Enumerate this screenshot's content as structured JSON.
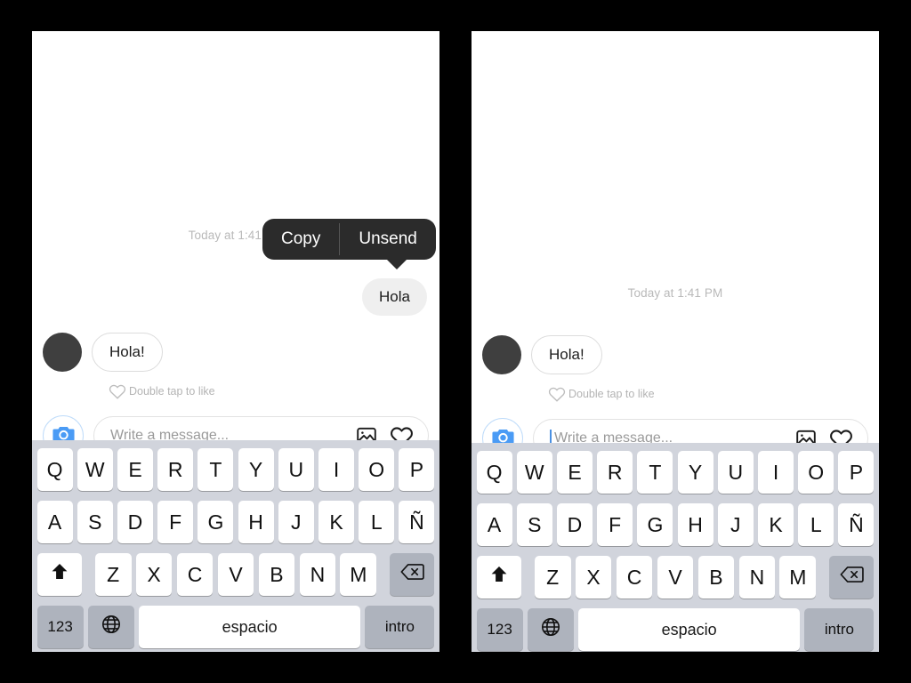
{
  "app": {
    "name": "Instagram Direct Message",
    "platform": "iOS",
    "language": "es"
  },
  "panels": [
    {
      "id": "before-unsend",
      "timestamp": "Today at 1:41 PM",
      "context_menu": {
        "visible": true,
        "items": [
          {
            "label": "Copy",
            "name": "copy"
          },
          {
            "label": "Unsend",
            "name": "unsend"
          }
        ],
        "background_color": "#2b2b2b",
        "text_color": "#ffffff"
      },
      "sent_message": {
        "visible": true,
        "text": "Hola",
        "bubble_color": "#efefef",
        "text_color": "#1c1c1c"
      },
      "received_message": {
        "text": "Hola!",
        "bubble_color": "#ffffff",
        "border_color": "#dcdcdc",
        "avatar_color": "#3f3f3f"
      },
      "like_hint": "Double tap to like",
      "composer": {
        "placeholder": "Write a message...",
        "caret_visible": false,
        "camera_icon_color": "#4a9bf5",
        "camera_ring_color": "#bfdcfa"
      }
    },
    {
      "id": "after-unsend",
      "timestamp": "Today at 1:41 PM",
      "context_menu": {
        "visible": false,
        "items": []
      },
      "sent_message": {
        "visible": false,
        "text": ""
      },
      "received_message": {
        "text": "Hola!",
        "bubble_color": "#ffffff",
        "border_color": "#dcdcdc",
        "avatar_color": "#3f3f3f"
      },
      "like_hint": "Double tap to like",
      "composer": {
        "placeholder": "Write a message...",
        "caret_visible": true,
        "camera_icon_color": "#4a9bf5",
        "camera_ring_color": "#bfdcfa"
      }
    }
  ],
  "keyboard": {
    "layout": "QWERTY-ES",
    "background_color": "#d1d4dc",
    "key_color": "#ffffff",
    "special_key_color": "#aeb3bd",
    "rows": [
      [
        "Q",
        "W",
        "E",
        "R",
        "T",
        "Y",
        "U",
        "I",
        "O",
        "P"
      ],
      [
        "A",
        "S",
        "D",
        "F",
        "G",
        "H",
        "J",
        "K",
        "L",
        "Ñ"
      ],
      [
        "Z",
        "X",
        "C",
        "V",
        "B",
        "N",
        "M"
      ]
    ],
    "shift_key": "shift-icon",
    "backspace_key": "backspace-icon",
    "numbers_key": "123",
    "globe_key": "globe-icon",
    "space_key": "espacio",
    "return_key": "intro"
  }
}
